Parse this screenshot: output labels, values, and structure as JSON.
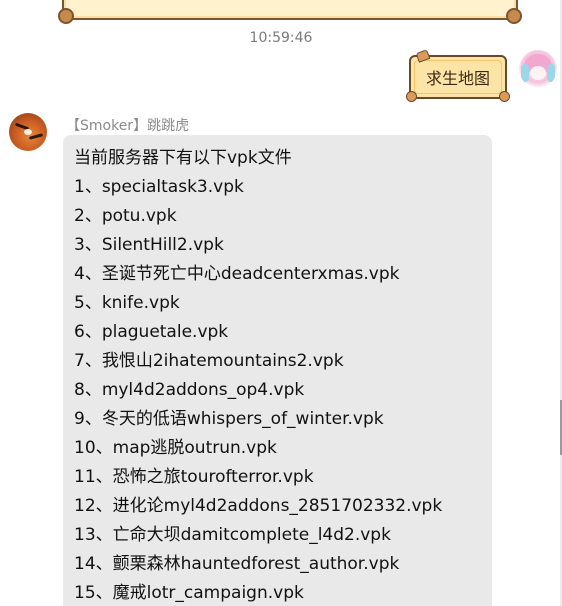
{
  "timestamp": "10:59:46",
  "outgoing": {
    "text": "求生地图"
  },
  "incoming": {
    "sender": "【Smoker】跳跳虎",
    "lines": [
      "当前服务器下有以下vpk文件",
      "1、specialtask3.vpk",
      "2、potu.vpk",
      "3、SilentHill2.vpk",
      "4、圣诞节死亡中心deadcenterxmas.vpk",
      "5、knife.vpk",
      "6、plaguetale.vpk",
      "7、我恨山2ihatemountains2.vpk",
      "8、myl4d2addons_op4.vpk",
      "9、冬天的低语whispers_of_winter.vpk",
      "10、map逃脱outrun.vpk",
      "11、恐怖之旅tourofterror.vpk",
      "12、进化论myl4d2addons_2851702332.vpk",
      "13、亡命大坝damitcomplete_l4d2.vpk",
      "14、颤栗森林hauntedforest_author.vpk",
      "15、魔戒lotr_campaign.vpk"
    ]
  },
  "colors": {
    "incoming_bubble": "#e9e9e9",
    "outgoing_bubble": "#fbe4a6",
    "bubble_border": "#6a4a2a",
    "timestamp": "#7a7a7a"
  },
  "icons": {
    "self_avatar": "anime-girl-avatar",
    "sender_avatar": "tiger-avatar"
  }
}
